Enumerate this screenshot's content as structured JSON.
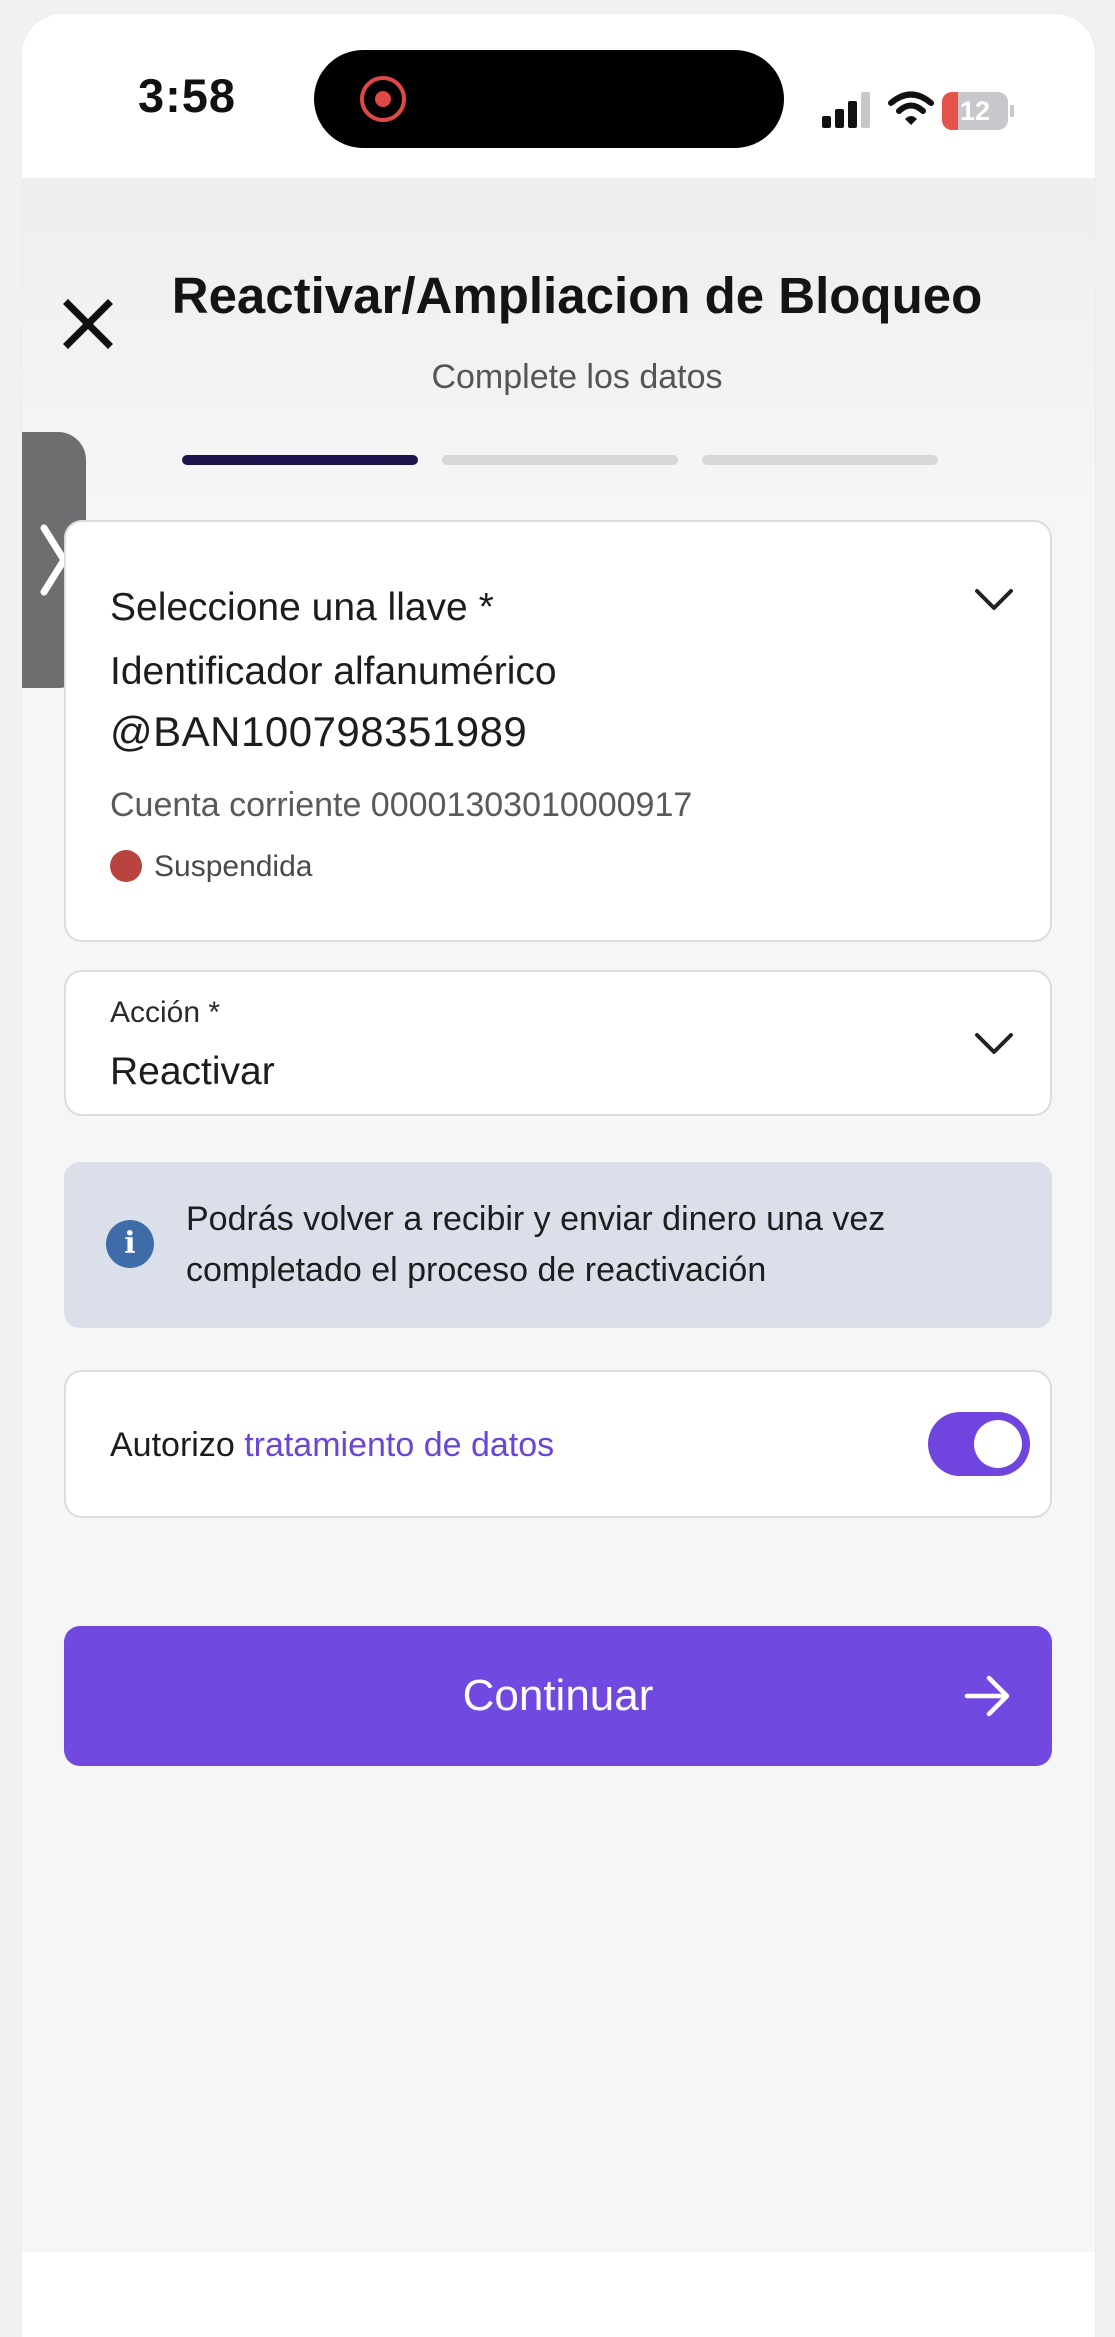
{
  "status_bar": {
    "time": "3:58",
    "battery_level": "12",
    "icons": [
      "record-indicator-icon",
      "signal-icon",
      "wifi-icon",
      "battery-icon"
    ]
  },
  "header": {
    "title": "Reactivar/Ampliacion de Bloqueo",
    "subtitle": "Complete los datos",
    "steps_total": 3,
    "current_step": 1,
    "close_icon": "close-icon",
    "side_tab_icon": "chevron-right-icon"
  },
  "key_select": {
    "label": "Seleccione una llave *",
    "key_type": "Identificador alfanumérico",
    "key_value": "@BAN100798351989",
    "account": "Cuenta corriente 00001303010000917",
    "status": "Suspendida",
    "status_color": "#b9433f"
  },
  "action_select": {
    "label": "Acción *",
    "value": "Reactivar"
  },
  "info": {
    "text": "Podrás volver a recibir y enviar dinero una vez completado el proceso de reactivación",
    "icon": "info-icon",
    "background": "#dadfe9"
  },
  "consent": {
    "prefix": "Autorizo ",
    "link": "tratamiento de datos",
    "toggle_on": true
  },
  "continue_button": {
    "label": "Continuar",
    "icon": "arrow-right-icon",
    "color": "#7149e1"
  },
  "colors": {
    "accent": "#7149e1",
    "stepper_active": "#1c1550",
    "stepper_inactive": "#d7d7da"
  }
}
